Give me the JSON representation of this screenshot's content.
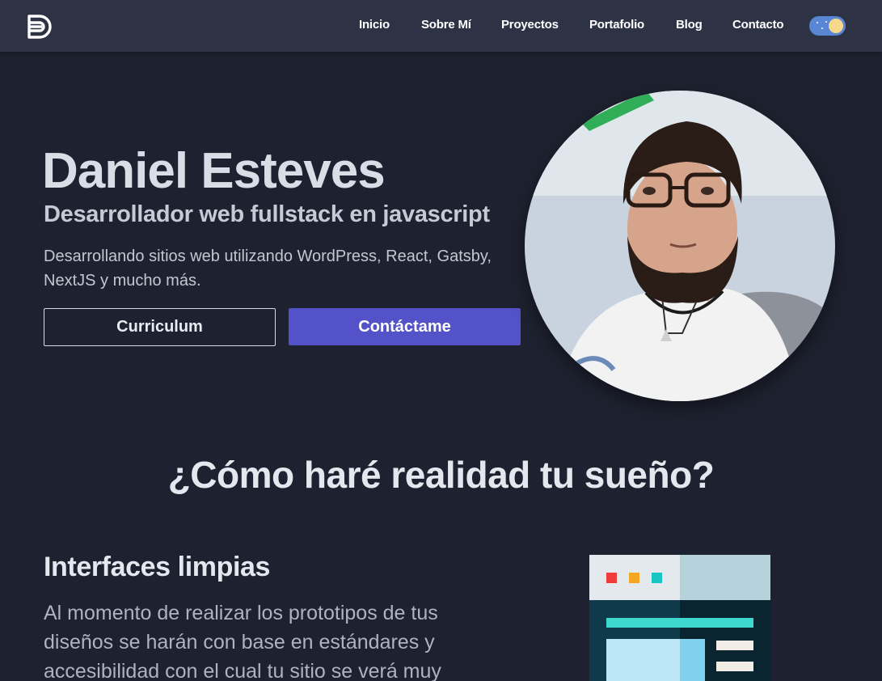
{
  "nav": {
    "logo_icon": "logo-d-icon",
    "links": [
      "Inicio",
      "Sobre Mí",
      "Proyectos",
      "Portafolio",
      "Blog",
      "Contacto"
    ],
    "theme_toggle_icon": "moon-icon"
  },
  "hero": {
    "name": "Daniel Esteves",
    "role": "Desarrollador web fullstack en javascript",
    "description": "Desarrollando sitios web utilizando WordPress, React, Gatsby, NextJS y mucho más.",
    "cv_button": "Curriculum",
    "contact_button": "Contáctame",
    "avatar_icon": "profile-photo"
  },
  "section": {
    "title": "¿Cómo haré realidad tu sueño?",
    "feature": {
      "title": "Interfaces limpias",
      "text": "Al momento de realizar los prototipos de tus diseños se harán con base en estándares y accesibilidad con el cual tu sitio se verá muy",
      "illustration_icon": "browser-window-illustration"
    }
  },
  "colors": {
    "background": "#1e2230",
    "navbar": "#2d3245",
    "accent": "#5352c8"
  }
}
